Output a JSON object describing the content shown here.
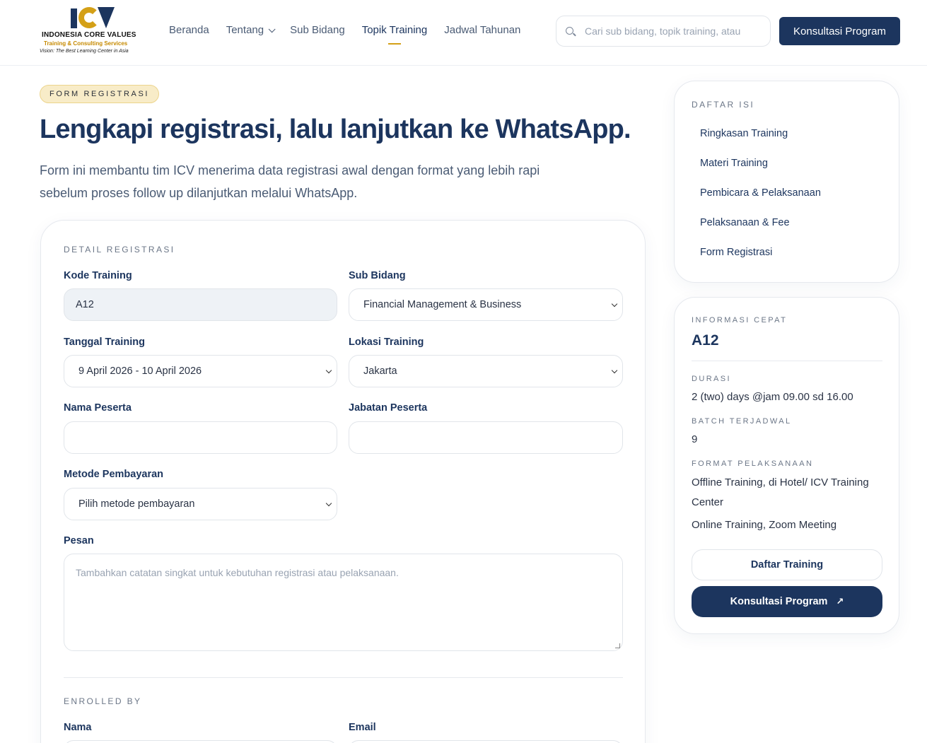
{
  "header": {
    "logo": {
      "name": "INDONESIA CORE VALUES",
      "tagline": "Training & Consulting Services",
      "vision": "Vision: The Best Learning Center in Asia"
    },
    "nav": [
      "Beranda",
      "Tentang",
      "Sub Bidang",
      "Topik Training",
      "Jadwal Tahunan"
    ],
    "active_nav": "Topik Training",
    "search_placeholder": "Cari sub bidang, topik training, atau",
    "cta_label": "Konsultasi Program"
  },
  "hero": {
    "badge": "FORM REGISTRASI",
    "title": "Lengkapi registrasi, lalu lanjutkan ke WhatsApp.",
    "subtitle": "Form ini membantu tim ICV menerima data registrasi awal dengan format yang lebih rapi sebelum proses follow up dilanjutkan melalui WhatsApp."
  },
  "form": {
    "section_detail": "DETAIL REGISTRASI",
    "kode_label": "Kode Training",
    "kode_value": "A12",
    "sub_bidang_label": "Sub Bidang",
    "sub_bidang_value": "Financial Management & Business",
    "tanggal_label": "Tanggal Training",
    "tanggal_value": "9 April 2026 - 10 April 2026",
    "lokasi_label": "Lokasi Training",
    "lokasi_value": "Jakarta",
    "nama_peserta_label": "Nama Peserta",
    "nama_peserta_value": "",
    "jabatan_label": "Jabatan Peserta",
    "jabatan_value": "",
    "metode_label": "Metode Pembayaran",
    "metode_value": "Pilih metode pembayaran",
    "pesan_label": "Pesan",
    "pesan_placeholder": "Tambahkan catatan singkat untuk kebutuhan registrasi atau pelaksanaan.",
    "section_enrolled": "ENROLLED BY",
    "nama_label": "Nama",
    "email_label": "Email"
  },
  "toc": {
    "title": "DAFTAR ISI",
    "items": [
      "Ringkasan Training",
      "Materi Training",
      "Pembicara & Pelaksanaan",
      "Pelaksanaan & Fee",
      "Form Registrasi"
    ]
  },
  "info": {
    "title": "INFORMASI CEPAT",
    "code": "A12",
    "durasi_label": "DURASI",
    "durasi_value": "2 (two) days @jam 09.00 sd 16.00",
    "batch_label": "BATCH TERJADWAL",
    "batch_value": "9",
    "format_label": "FORMAT PELAKSANAAN",
    "format_values": [
      "Offline Training, di Hotel/ ICV Training Center",
      "Online Training, Zoom Meeting"
    ],
    "btn_daftar": "Daftar Training",
    "btn_konsultasi": "Konsultasi Program"
  },
  "colors": {
    "primary": "#1c355e",
    "accent": "#d4a017",
    "badge_bg": "#f8ecc8"
  }
}
